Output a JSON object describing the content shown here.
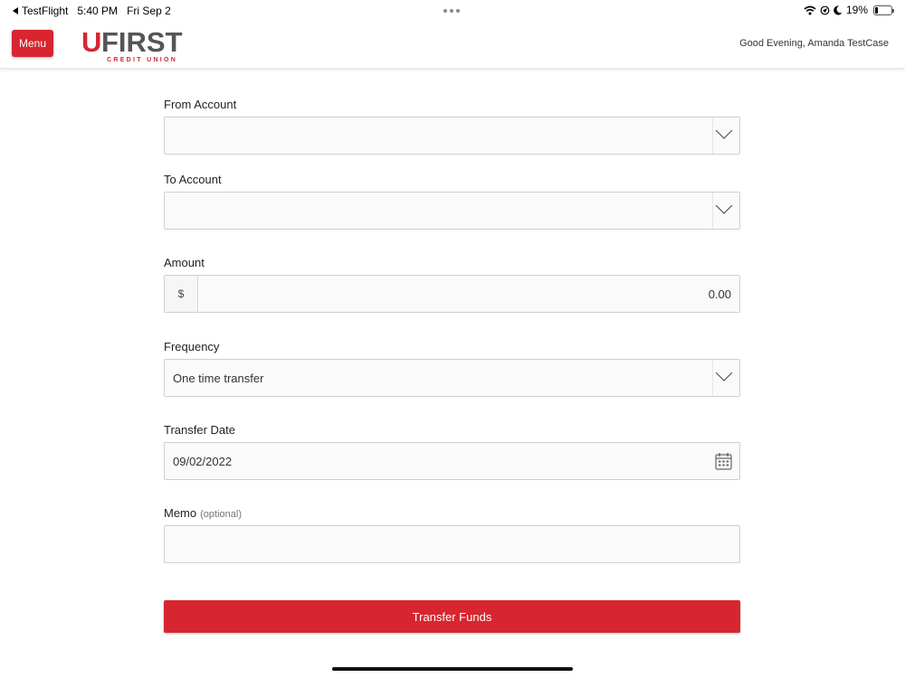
{
  "status_bar": {
    "back_app": "TestFlight",
    "time": "5:40 PM",
    "date": "Fri Sep 2",
    "battery": "19%",
    "battery_level": 0.19
  },
  "header": {
    "menu_label": "Menu",
    "logo_text": "UFIRST",
    "logo_subtext": "CREDIT UNION",
    "greeting": "Good Evening, Amanda TestCase",
    "brand_color": "#d7262f"
  },
  "form": {
    "from_account": {
      "label": "From Account",
      "value": ""
    },
    "to_account": {
      "label": "To Account",
      "value": ""
    },
    "amount": {
      "label": "Amount",
      "prefix": "$",
      "value": "0.00"
    },
    "frequency": {
      "label": "Frequency",
      "value": "One time transfer"
    },
    "transfer_date": {
      "label": "Transfer Date",
      "value": "09/02/2022"
    },
    "memo": {
      "label": "Memo",
      "optional_note": "(optional)",
      "value": ""
    },
    "submit_label": "Transfer Funds"
  },
  "icons": [
    "back-arrow-icon",
    "wifi-icon",
    "location-icon",
    "moon-icon",
    "battery-icon",
    "chevron-down-icon",
    "calendar-icon"
  ]
}
